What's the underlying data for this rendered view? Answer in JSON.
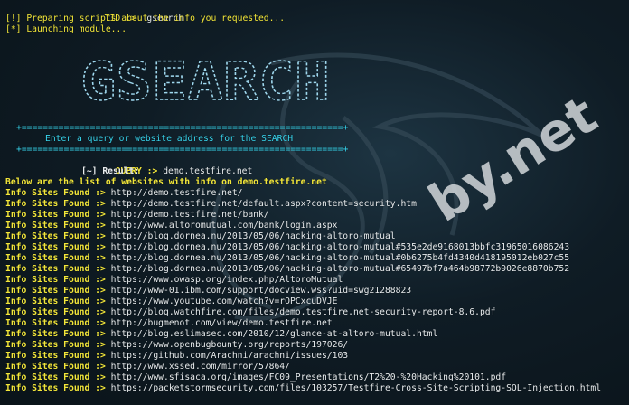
{
  "terminal": {
    "tid_prompt": "TID :>",
    "tid_command": "gsearch",
    "msg_preparing": "[!] Preparing scripts about the info you requested...",
    "msg_launching": "[*] Launching module...",
    "banner_art": "GSEARCH",
    "separator": "+=============================================================+",
    "query_instruction": "Enter a query or website address for the SEARCH",
    "query_prompt": "QUERY :>",
    "query_value": "demo.testfire.net",
    "result_header": "[~] Result:",
    "list_header": "Below are the list of websites with info on demo.testfire.net",
    "result_label": "Info Sites Found :>",
    "results": [
      "http://demo.testfire.net/",
      "http://demo.testfire.net/default.aspx?content=security.htm",
      "http://demo.testfire.net/bank/",
      "http://www.altoromutual.com/bank/login.aspx",
      "http://blog.dornea.nu/2013/05/06/hacking-altoro-mutual",
      "http://blog.dornea.nu/2013/05/06/hacking-altoro-mutual#535e2de9168013bbfc31965016086243",
      "http://blog.dornea.nu/2013/05/06/hacking-altoro-mutual#0b6275b4fd4340d418195012eb027c55",
      "http://blog.dornea.nu/2013/05/06/hacking-altoro-mutual#65497bf7a464b98772b9026e8870b752",
      "https://www.owasp.org/index.php/AltoroMutual",
      "http://www-01.ibm.com/support/docview.wss?uid=swg21288823",
      "https://www.youtube.com/watch?v=rOPCxcuDVJE",
      "http://blog.watchfire.com/files/demo.testfire.net-security-report-8.6.pdf",
      "http://bugmenot.com/view/demo.testfire.net",
      "http://blog.eslimasec.com/2010/12/glance-at-altoro-mutual.html",
      "https://www.openbugbounty.org/reports/197026/",
      "https://github.com/Arachni/arachni/issues/103",
      "http://www.xssed.com/mirror/57864/",
      "http://www.sfisaca.org/images/FC09_Presentations/T2%20-%20Hacking%20101.pdf",
      "https://packetstormsecurity.com/files/103257/Testfire-Cross-Site-Scripting-SQL-Injection.html"
    ],
    "watermark_text": "by.net"
  },
  "colors": {
    "yellow": "#f3e73a",
    "cyan": "#38d6ee",
    "white": "#e8ecee",
    "background": "#0f1c25"
  },
  "icons": {
    "background": "kali-dragon-logo"
  }
}
